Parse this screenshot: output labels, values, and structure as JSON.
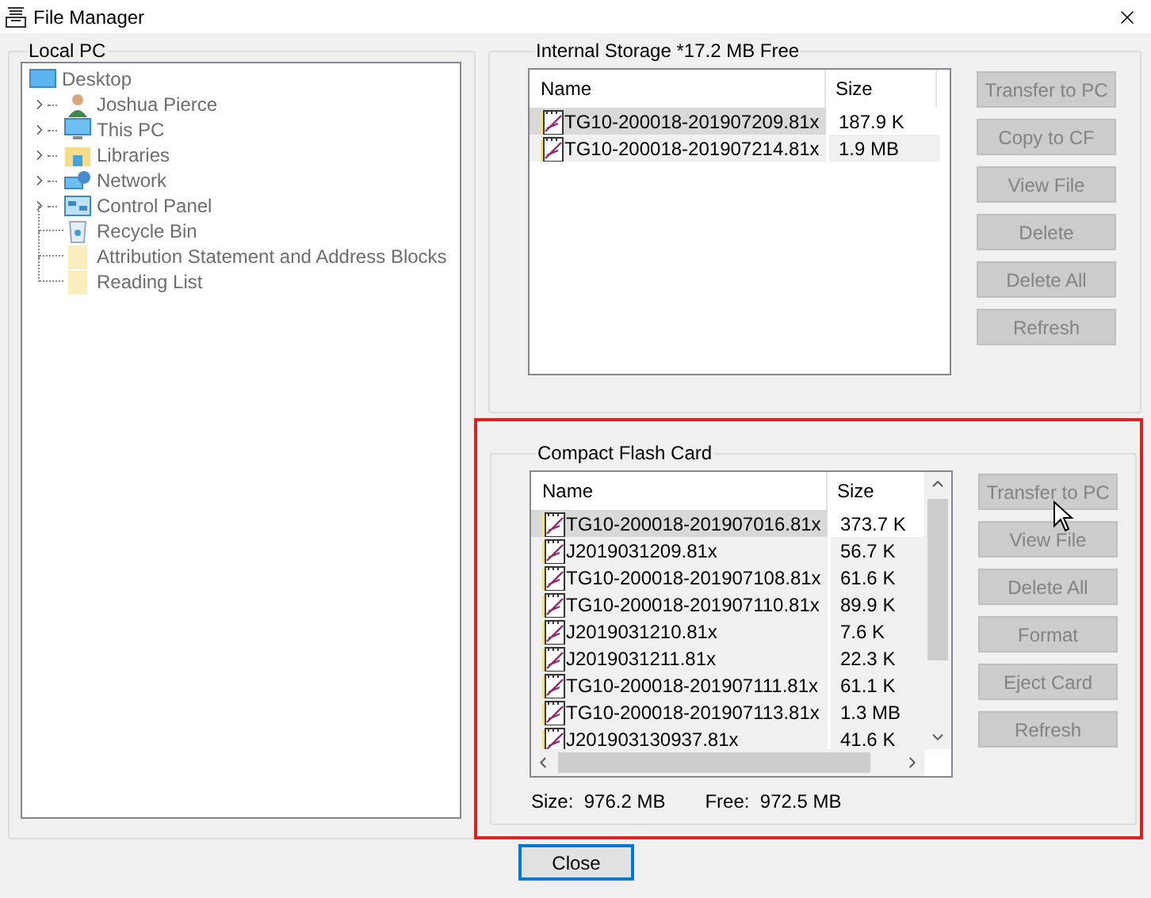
{
  "window": {
    "title": "File Manager"
  },
  "local_pc": {
    "title": "Local PC",
    "disabled": true,
    "tree": [
      {
        "label": "Desktop",
        "children": [
          {
            "label": "Joshua Pierce",
            "expanded": false
          },
          {
            "label": "This PC",
            "expanded": false
          },
          {
            "label": "Libraries",
            "expanded": false
          },
          {
            "label": "Network",
            "expanded": false
          },
          {
            "label": "Control Panel",
            "expanded": false
          },
          {
            "label": "Recycle Bin"
          },
          {
            "label": "Attribution Statement and Address Blocks"
          },
          {
            "label": "Reading List"
          }
        ]
      }
    ]
  },
  "internal_storage": {
    "title": "Internal Storage *17.2 MB Free",
    "columns": [
      "Name",
      "Size"
    ],
    "rows": [
      {
        "name": "TG10-200018-201907209.81x",
        "size": "187.9 K",
        "selected": true
      },
      {
        "name": "TG10-200018-201907214.81x",
        "size": "1.9 MB",
        "selected": false
      }
    ],
    "buttons": [
      {
        "label": "Transfer to PC",
        "disabled": true
      },
      {
        "label": "Copy to CF",
        "disabled": true
      },
      {
        "label": "View File",
        "disabled": true
      },
      {
        "label": "Delete",
        "disabled": true
      },
      {
        "label": "Delete All",
        "disabled": true
      },
      {
        "label": "Refresh",
        "disabled": true
      }
    ]
  },
  "compact_flash_card": {
    "title": "Compact Flash Card",
    "highlighted": true,
    "columns": [
      "Name",
      "Size"
    ],
    "rows": [
      {
        "name": "TG10-200018-201907016.81x",
        "size": "373.7 K",
        "selected": true
      },
      {
        "name": "J2019031209.81x",
        "size": "56.7 K",
        "selected": false
      },
      {
        "name": "TG10-200018-201907108.81x",
        "size": "61.6 K",
        "selected": false
      },
      {
        "name": "TG10-200018-201907110.81x",
        "size": "89.9 K",
        "selected": false
      },
      {
        "name": "J2019031210.81x",
        "size": "7.6 K",
        "selected": false
      },
      {
        "name": "J2019031211.81x",
        "size": "22.3 K",
        "selected": false
      },
      {
        "name": "TG10-200018-201907111.81x",
        "size": "61.1 K",
        "selected": false
      },
      {
        "name": "TG10-200018-201907113.81x",
        "size": "1.3 MB",
        "selected": false
      },
      {
        "name": "J201903130937.81x",
        "size": "41.6 K",
        "selected": false
      }
    ],
    "buttons": [
      {
        "label": "Transfer to PC",
        "disabled": true
      },
      {
        "label": "View File",
        "disabled": true
      },
      {
        "label": "Delete All",
        "disabled": true
      },
      {
        "label": "Format",
        "disabled": true
      },
      {
        "label": "Eject Card",
        "disabled": true
      },
      {
        "label": "Refresh",
        "disabled": true
      }
    ],
    "size": "Size:  976.2 MB",
    "free": "Free:  972.5 MB"
  },
  "buttons": [
    {
      "label": "Close",
      "default": true
    }
  ]
}
